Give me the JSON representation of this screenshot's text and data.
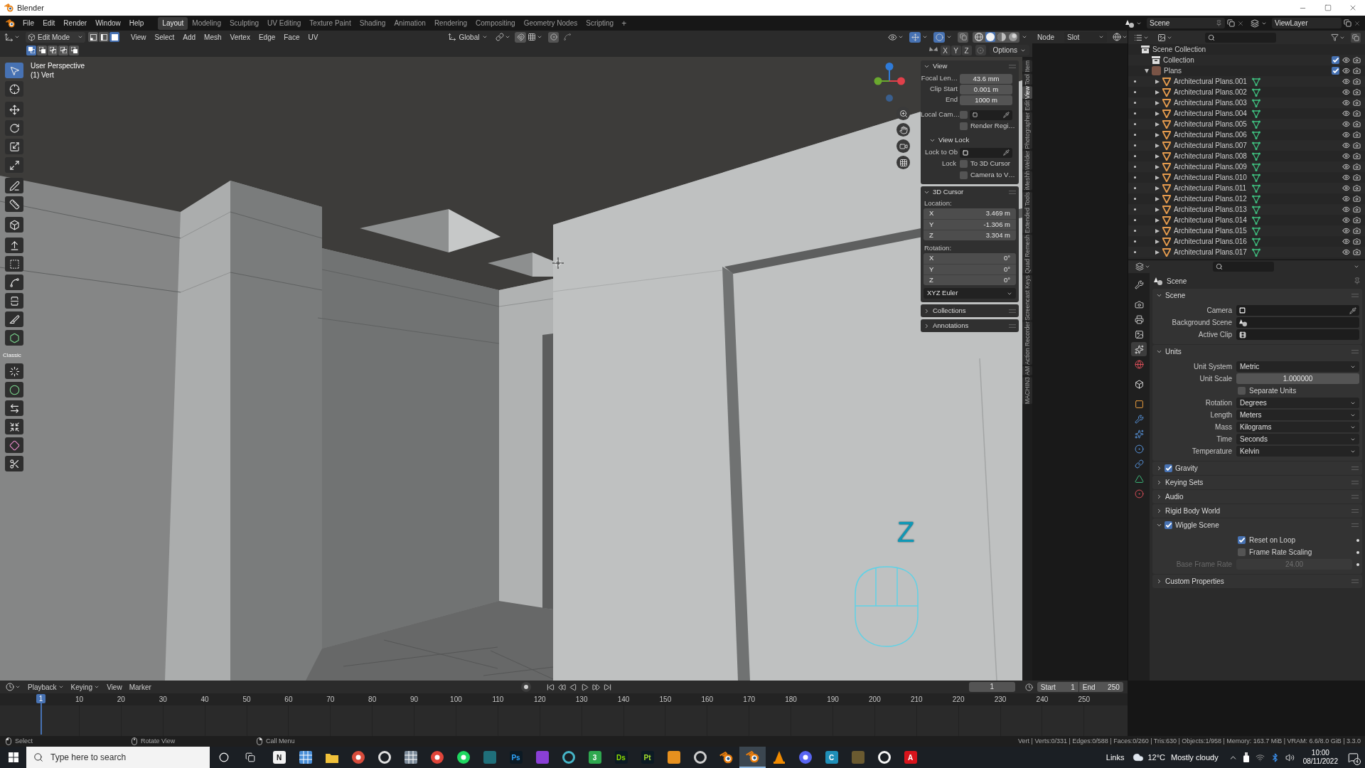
{
  "window": {
    "title": "Blender"
  },
  "top_bar": {
    "menus": [
      "File",
      "Edit",
      "Render",
      "Window",
      "Help"
    ],
    "workspaces": [
      {
        "label": "Layout",
        "selected": true
      },
      {
        "label": "Modeling",
        "selected": false
      },
      {
        "label": "Sculpting",
        "selected": false
      },
      {
        "label": "UV Editing",
        "selected": false
      },
      {
        "label": "Texture Paint",
        "selected": false
      },
      {
        "label": "Shading",
        "selected": false
      },
      {
        "label": "Animation",
        "selected": false
      },
      {
        "label": "Rendering",
        "selected": false
      },
      {
        "label": "Compositing",
        "selected": false
      },
      {
        "label": "Geometry Nodes",
        "selected": false
      },
      {
        "label": "Scripting",
        "selected": false
      }
    ],
    "add_workspace": "+",
    "scene": "Scene",
    "view_layer": "ViewLayer"
  },
  "viewport_header": {
    "mode": "Edit Mode",
    "select_modes": [
      {
        "kind": "vertex",
        "selected": false
      },
      {
        "kind": "edge",
        "selected": false
      },
      {
        "kind": "face",
        "selected": true
      }
    ],
    "menus": [
      "View",
      "Select",
      "Add",
      "Mesh",
      "Vertex",
      "Edge",
      "Face",
      "UV"
    ],
    "orientation": "Global",
    "shading_modes": [
      {
        "kind": "wireframe",
        "selected": false
      },
      {
        "kind": "solid",
        "selected": true
      },
      {
        "kind": "material",
        "selected": false
      },
      {
        "kind": "rendered",
        "selected": false
      }
    ],
    "node_label": "Node",
    "slot": "Slot",
    "box_modes": [
      {
        "kind": "set",
        "selected": true
      },
      {
        "kind": "extend",
        "selected": false
      },
      {
        "kind": "subtract",
        "selected": false
      },
      {
        "kind": "invert",
        "selected": false
      },
      {
        "kind": "intersect",
        "selected": false
      }
    ],
    "mirror_axes": [
      {
        "label": "X",
        "selected": false
      },
      {
        "label": "Y",
        "selected": false
      },
      {
        "label": "Z",
        "selected": false
      }
    ],
    "options": "Options"
  },
  "viewport": {
    "view_name": "User Perspective",
    "selection_info": "(1) Vert",
    "screencast_key": "Z"
  },
  "toolbar": {
    "tool_groups": [
      [
        {
          "kind": "select_box",
          "selected": true
        },
        {
          "kind": "cursor",
          "selected": false
        }
      ],
      [
        {
          "kind": "move",
          "selected": false
        },
        {
          "kind": "rotate",
          "selected": false
        },
        {
          "kind": "scale",
          "selected": false
        },
        {
          "kind": "transform",
          "selected": false
        }
      ],
      [
        {
          "kind": "annotate",
          "selected": false
        },
        {
          "kind": "measure",
          "selected": false
        }
      ],
      [
        {
          "kind": "add_cube",
          "selected": false
        }
      ],
      [
        {
          "kind": "extrude",
          "selected": false
        },
        {
          "kind": "inset",
          "selected": false
        },
        {
          "kind": "bevel",
          "selected": false
        },
        {
          "kind": "loop_cut",
          "selected": false
        },
        {
          "kind": "knife",
          "selected": false
        },
        {
          "kind": "poly_build",
          "selected": false
        }
      ]
    ],
    "classic_label": "Classic",
    "classic_tools": [
      {
        "kind": "spin",
        "selected": false
      },
      {
        "kind": "smooth",
        "selected": false
      },
      {
        "kind": "edge_slide",
        "selected": false
      },
      {
        "kind": "shrink",
        "selected": false
      },
      {
        "kind": "shear",
        "selected": false
      },
      {
        "kind": "rip",
        "selected": false
      }
    ]
  },
  "sidebar": {
    "tabs": [
      {
        "label": "Item",
        "selected": false
      },
      {
        "label": "Tool",
        "selected": false
      },
      {
        "label": "View",
        "selected": true
      },
      {
        "label": "Edit",
        "selected": false
      },
      {
        "label": "Photographer",
        "selected": false
      },
      {
        "label": "Welder",
        "selected": false
      },
      {
        "label": "iMeshh",
        "selected": false
      },
      {
        "label": "Extended Tools",
        "selected": false
      },
      {
        "label": "Quad Remesh",
        "selected": false
      },
      {
        "label": "Screencast Keys",
        "selected": false
      },
      {
        "label": "Action Recorder",
        "selected": false
      },
      {
        "label": "AM",
        "selected": false
      },
      {
        "label": "MACHIN3",
        "selected": false
      }
    ],
    "view_panel": {
      "title": "View",
      "expanded": true,
      "rows": [
        {
          "kind": "number",
          "label": "Focal Len…",
          "value": "43.6 mm"
        },
        {
          "kind": "number",
          "label": "Clip Start",
          "value": "0.001 m"
        },
        {
          "kind": "number",
          "label": "End",
          "value": "1000 m"
        },
        {
          "kind": "checked_picker",
          "label": "Local Cam…",
          "checked": false
        },
        {
          "kind": "check",
          "label": "Render Regi…",
          "checked": false
        },
        {
          "kind": "subheader",
          "label": "View Lock",
          "expanded": true
        },
        {
          "kind": "picker",
          "label": "Lock to Ob"
        },
        {
          "kind": "check",
          "prefix": "Lock",
          "label": "To 3D Cursor",
          "checked": false
        },
        {
          "kind": "check",
          "label": "Camera to V…",
          "checked": false
        }
      ]
    },
    "cursor_panel": {
      "title": "3D Cursor",
      "expanded": true,
      "location_label": "Location:",
      "location": [
        {
          "axis": "X",
          "value": "3.469 m"
        },
        {
          "axis": "Y",
          "value": "-1.306 m"
        },
        {
          "axis": "Z",
          "value": "3.304 m"
        }
      ],
      "rotation_label": "Rotation:",
      "rotation": [
        {
          "axis": "X",
          "value": "0°"
        },
        {
          "axis": "Y",
          "value": "0°"
        },
        {
          "axis": "Z",
          "value": "0°"
        }
      ],
      "rotation_mode": "XYZ Euler"
    },
    "closed_panels": [
      {
        "title": "Collections",
        "expanded": false
      },
      {
        "title": "Annotations",
        "expanded": false
      }
    ]
  },
  "outliner": {
    "tree": [
      {
        "label": "Scene Collection",
        "kind": "scene_collection",
        "children": [
          {
            "label": "Collection",
            "kind": "collection",
            "checked": true
          },
          {
            "label": "Plans",
            "kind": "tagged_collection",
            "checked": true,
            "expanded": true,
            "children": [
              {
                "label": "Architectural Plans.001",
                "kind": "mesh_object",
                "expanded": false
              },
              {
                "label": "Architectural Plans.002",
                "kind": "mesh_object",
                "expanded": false
              },
              {
                "label": "Architectural Plans.003",
                "kind": "mesh_object",
                "expanded": false
              },
              {
                "label": "Architectural Plans.004",
                "kind": "mesh_object",
                "expanded": false
              },
              {
                "label": "Architectural Plans.005",
                "kind": "mesh_object",
                "expanded": false
              },
              {
                "label": "Architectural Plans.006",
                "kind": "mesh_object",
                "expanded": false
              },
              {
                "label": "Architectural Plans.007",
                "kind": "mesh_object",
                "expanded": false
              },
              {
                "label": "Architectural Plans.008",
                "kind": "mesh_object",
                "expanded": false
              },
              {
                "label": "Architectural Plans.009",
                "kind": "mesh_object",
                "expanded": false
              },
              {
                "label": "Architectural Plans.010",
                "kind": "mesh_object",
                "expanded": false
              },
              {
                "label": "Architectural Plans.011",
                "kind": "mesh_object",
                "expanded": false
              },
              {
                "label": "Architectural Plans.012",
                "kind": "mesh_object",
                "expanded": false
              },
              {
                "label": "Architectural Plans.013",
                "kind": "mesh_object",
                "expanded": false
              },
              {
                "label": "Architectural Plans.014",
                "kind": "mesh_object",
                "expanded": false
              },
              {
                "label": "Architectural Plans.015",
                "kind": "mesh_object",
                "expanded": false
              },
              {
                "label": "Architectural Plans.016",
                "kind": "mesh_object",
                "expanded": false
              },
              {
                "label": "Architectural Plans.017",
                "kind": "mesh_object",
                "expanded": false
              }
            ]
          }
        ]
      }
    ]
  },
  "properties": {
    "tab_groups": [
      [
        {
          "kind": "tool",
          "selected": false
        }
      ],
      [
        {
          "kind": "render",
          "selected": false
        },
        {
          "kind": "output",
          "selected": false
        },
        {
          "kind": "view_layer",
          "selected": false
        },
        {
          "kind": "scene",
          "selected": true
        },
        {
          "kind": "world",
          "selected": false
        }
      ],
      [
        {
          "kind": "collection",
          "selected": false
        }
      ],
      [
        {
          "kind": "object",
          "selected": false
        },
        {
          "kind": "modifiers",
          "selected": false
        },
        {
          "kind": "particles",
          "selected": false
        },
        {
          "kind": "physics",
          "selected": false
        },
        {
          "kind": "constraints",
          "selected": false
        },
        {
          "kind": "data",
          "selected": false
        },
        {
          "kind": "material",
          "selected": false
        }
      ]
    ],
    "context": "Scene",
    "panels": [
      {
        "title": "Scene",
        "expanded": true,
        "decorators": false,
        "rows": [
          {
            "kind": "camera_picker",
            "label": "Camera"
          },
          {
            "kind": "scene_picker",
            "label": "Background Scene"
          },
          {
            "kind": "clip_picker",
            "label": "Active Clip"
          }
        ]
      },
      {
        "title": "Units",
        "expanded": true,
        "decorators": false,
        "rows": [
          {
            "kind": "dropdown",
            "label": "Unit System",
            "value": "Metric"
          },
          {
            "kind": "number",
            "label": "Unit Scale",
            "value": "1.000000",
            "disabled": false
          },
          {
            "kind": "check",
            "label": "Separate Units",
            "checked": false
          },
          {
            "kind": "dropdown",
            "label": "Rotation",
            "value": "Degrees"
          },
          {
            "kind": "dropdown",
            "label": "Length",
            "value": "Meters"
          },
          {
            "kind": "dropdown",
            "label": "Mass",
            "value": "Kilograms"
          },
          {
            "kind": "dropdown",
            "label": "Time",
            "value": "Seconds"
          },
          {
            "kind": "dropdown",
            "label": "Temperature",
            "value": "Kelvin"
          }
        ]
      },
      {
        "title": "Gravity",
        "expanded": false,
        "checked": true
      },
      {
        "title": "Keying Sets",
        "expanded": false
      },
      {
        "title": "Audio",
        "expanded": false
      },
      {
        "title": "Rigid Body World",
        "expanded": false
      },
      {
        "title": "Wiggle Scene",
        "expanded": true,
        "checked": true,
        "decorators": true,
        "rows": [
          {
            "kind": "check",
            "label": "Reset on Loop",
            "checked": true
          },
          {
            "kind": "check",
            "label": "Frame Rate Scaling",
            "checked": false
          },
          {
            "kind": "number",
            "label": "Base Frame Rate",
            "value": "24.00",
            "disabled": true
          }
        ]
      },
      {
        "title": "Custom Properties",
        "expanded": false
      }
    ]
  },
  "timeline": {
    "menus": [
      "Playback",
      "Keying",
      "View",
      "Marker"
    ],
    "current_frame": "1",
    "start_label": "Start",
    "start": "1",
    "end_label": "End",
    "end": "250",
    "playhead_frame": "1",
    "ruler_labels": [
      "10",
      "20",
      "30",
      "40",
      "50",
      "60",
      "70",
      "80",
      "90",
      "100",
      "110",
      "120",
      "130",
      "140",
      "150",
      "160",
      "170",
      "180",
      "190",
      "200",
      "210",
      "220",
      "230",
      "240",
      "250"
    ]
  },
  "status_bar": {
    "hints": [
      {
        "kind": "left_click",
        "label": "Select"
      },
      {
        "kind": "middle_click",
        "label": "Rotate View"
      },
      {
        "kind": "right_click",
        "label": "Call Menu"
      }
    ],
    "stats": "Vert | Verts:0/331 | Edges:0/588 | Faces:0/260 | Tris:630 | Objects:1/958 | Memory: 163.7 MiB | VRAM: 6.6/8.0 GiB | 3.3.0"
  },
  "taskbar": {
    "search_placeholder": "Type here to search",
    "apps": [
      {
        "kind": "letter",
        "label": "N",
        "color": "#f2f2f2",
        "selected": false
      },
      {
        "kind": "grid",
        "color": "#4a8fd8",
        "selected": false
      },
      {
        "kind": "folder",
        "color": "#f0c13a",
        "selected": false
      },
      {
        "kind": "disc",
        "color": "#d84c3c",
        "selected": false
      },
      {
        "kind": "ring",
        "color": "#e0e0e0",
        "selected": false
      },
      {
        "kind": "grid",
        "color": "#7d8c9b",
        "selected": false
      },
      {
        "kind": "disc",
        "color": "#e0453a",
        "selected": false
      },
      {
        "kind": "disc",
        "color": "#1ed760",
        "selected": false
      },
      {
        "kind": "square",
        "color": "#1f6f7a",
        "selected": false
      },
      {
        "kind": "dark_letter",
        "label": "Ps",
        "color": "#31a8ff",
        "selected": false
      },
      {
        "kind": "square",
        "color": "#8a3fd6",
        "selected": false
      },
      {
        "kind": "ring",
        "color": "#46b6c8",
        "selected": false
      },
      {
        "kind": "letter",
        "label": "3",
        "color": "#2fa84f",
        "selected": false
      },
      {
        "kind": "dark_letter",
        "label": "Ds",
        "color": "#8ee000",
        "selected": false
      },
      {
        "kind": "dark_letter",
        "label": "Pt",
        "color": "#a6e22e",
        "selected": false
      },
      {
        "kind": "square",
        "color": "#e7901e",
        "selected": false
      },
      {
        "kind": "ring",
        "color": "#cfcfcf",
        "selected": false
      },
      {
        "kind": "blender",
        "color": "#e87d0d",
        "selected": false
      },
      {
        "kind": "blender",
        "color": "#e87d0d",
        "selected": true
      },
      {
        "kind": "cone",
        "color": "#f08a00",
        "selected": false
      },
      {
        "kind": "disc",
        "color": "#5865f2",
        "selected": false
      },
      {
        "kind": "letter",
        "label": "C",
        "color": "#1f8fb8",
        "selected": false
      },
      {
        "kind": "square",
        "color": "#6a5a30",
        "selected": false
      },
      {
        "kind": "ring",
        "color": "#f5f5f5",
        "selected": false
      },
      {
        "kind": "letter",
        "label": "A",
        "color": "#d8141c",
        "selected": false
      }
    ],
    "links": "Links",
    "temperature": "12°C",
    "weather": "Mostly cloudy",
    "time": "10:00",
    "date": "08/11/2022",
    "notification_count": "4"
  }
}
